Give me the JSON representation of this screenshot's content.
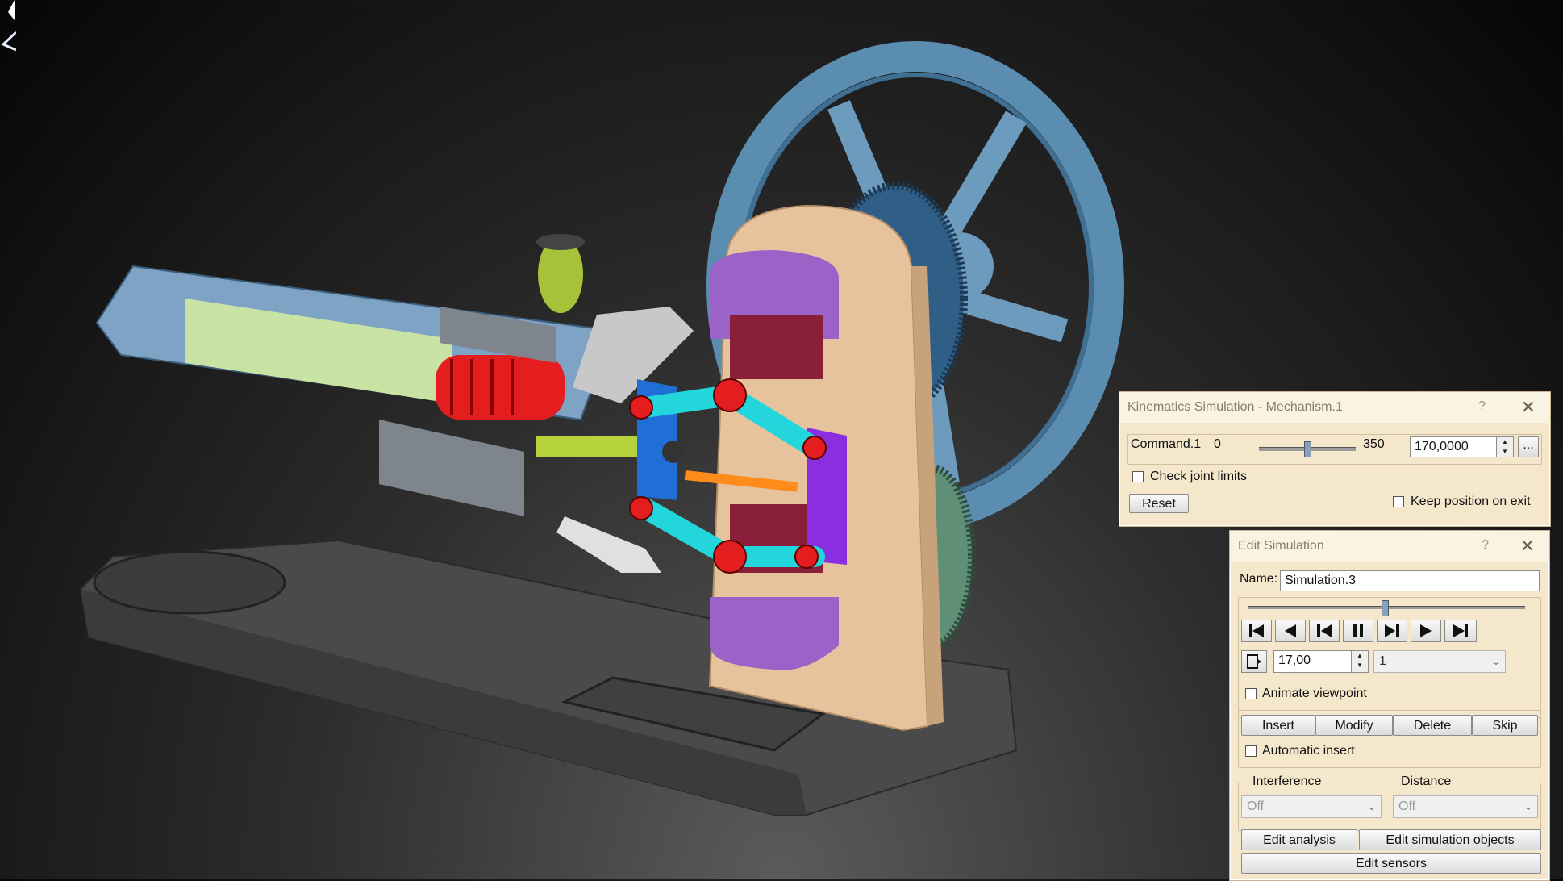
{
  "kinematics_dialog": {
    "title": "Kinematics Simulation - Mechanism.1",
    "help_icon": "?",
    "close_icon": "✕",
    "command_label": "Command.1",
    "slider_min": "0",
    "slider_max": "350",
    "slider_value_fraction": 0.49,
    "command_value": "170,0000",
    "more_button": "...",
    "check_joint_limits": "Check joint limits",
    "reset_button": "Reset",
    "keep_position": "Keep position on exit"
  },
  "edit_dialog": {
    "title": "Edit Simulation",
    "help_icon": "?",
    "close_icon": "✕",
    "name_label": "Name:",
    "name_value": "Simulation.3",
    "timeline_fraction": 0.49,
    "step_value": "17,00",
    "step_combo": "1",
    "animate_viewpoint": "Animate viewpoint",
    "insert_button": "Insert",
    "modify_button": "Modify",
    "delete_button": "Delete",
    "skip_button": "Skip",
    "automatic_insert": "Automatic insert",
    "interference_label": "Interference",
    "interference_value": "Off",
    "distance_label": "Distance",
    "distance_value": "Off",
    "edit_analysis": "Edit analysis",
    "edit_simulation_objects": "Edit simulation objects",
    "edit_sensors": "Edit sensors"
  },
  "colors": {
    "dialog_bg": "#f5e7cc",
    "flywheel": "#5b8db0",
    "plate": "#e6c39c",
    "purple": "#9b62c8",
    "cyan": "#22d6dc",
    "red": "#e41e1e",
    "cylinder": "#c9e3a4"
  }
}
